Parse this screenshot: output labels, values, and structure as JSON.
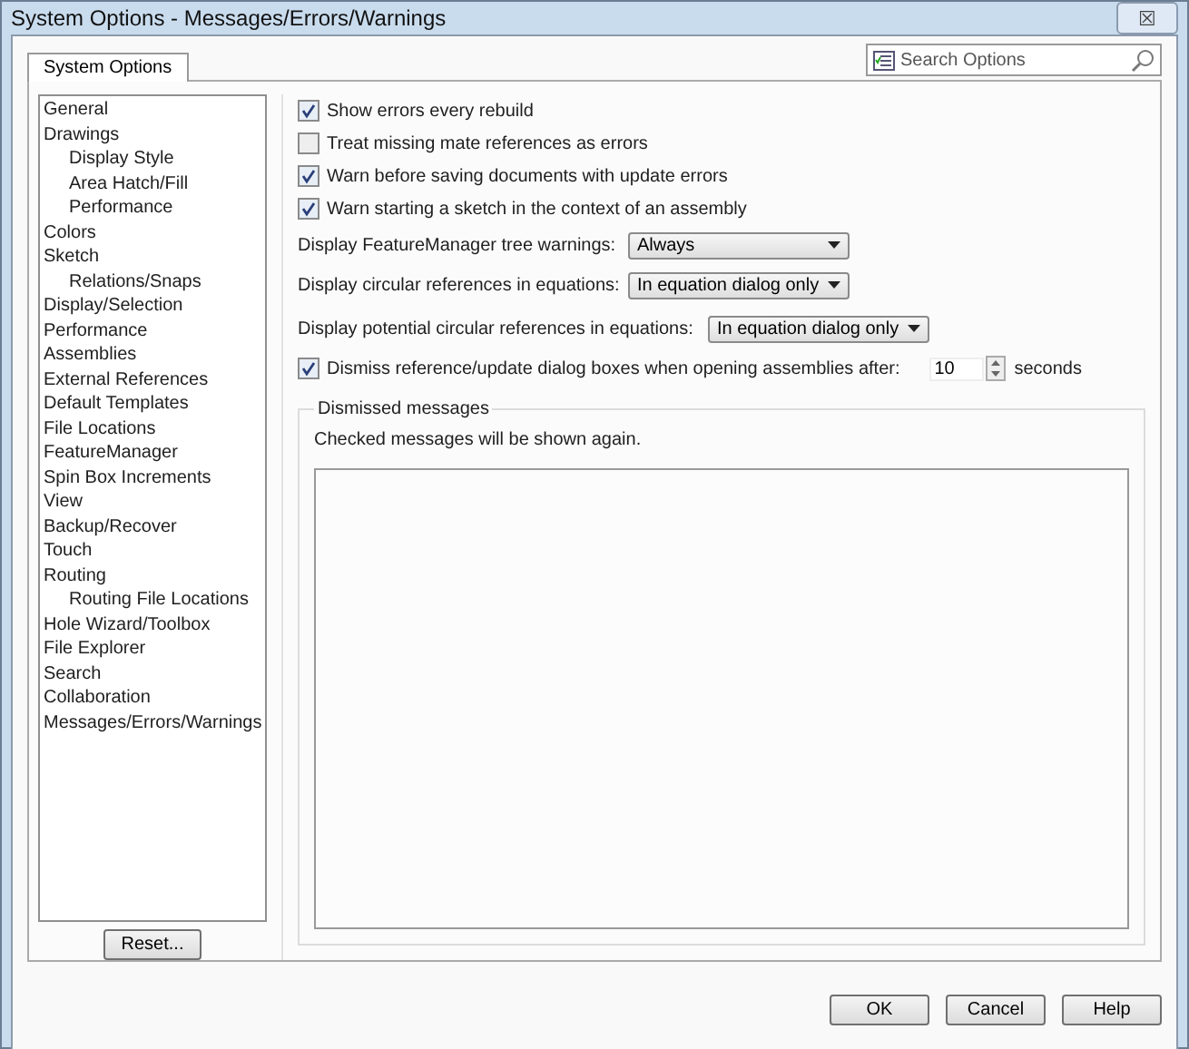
{
  "window": {
    "title": "System Options - Messages/Errors/Warnings",
    "close": "☒"
  },
  "tab": {
    "label": "System Options",
    "selected": true
  },
  "search": {
    "placeholder": "Search Options"
  },
  "tree": [
    {
      "label": "General"
    },
    {
      "label": "Drawings",
      "children": [
        {
          "label": "Display Style"
        },
        {
          "label": "Area Hatch/Fill"
        },
        {
          "label": "Performance"
        }
      ]
    },
    {
      "label": "Colors"
    },
    {
      "label": "Sketch",
      "children": [
        {
          "label": "Relations/Snaps"
        }
      ]
    },
    {
      "label": "Display/Selection"
    },
    {
      "label": "Performance"
    },
    {
      "label": "Assemblies"
    },
    {
      "label": "External References"
    },
    {
      "label": "Default Templates"
    },
    {
      "label": "File Locations"
    },
    {
      "label": "FeatureManager"
    },
    {
      "label": "Spin Box Increments"
    },
    {
      "label": "View"
    },
    {
      "label": "Backup/Recover"
    },
    {
      "label": "Touch"
    },
    {
      "label": "Routing",
      "children": [
        {
          "label": "Routing File Locations"
        }
      ]
    },
    {
      "label": "Hole Wizard/Toolbox"
    },
    {
      "label": "File Explorer"
    },
    {
      "label": "Search"
    },
    {
      "label": "Collaboration"
    },
    {
      "label": "Messages/Errors/Warnings"
    }
  ],
  "reset_button": "Reset...",
  "options": [
    {
      "kind": "checkbox",
      "label": "Show errors every rebuild",
      "checked": true
    },
    {
      "kind": "checkbox",
      "label": "Treat missing mate references as errors",
      "checked": false
    },
    {
      "kind": "checkbox",
      "label": "Warn before saving documents with update errors",
      "checked": true
    },
    {
      "kind": "checkbox",
      "label": "Warn starting a sketch in the context of an assembly",
      "checked": true
    },
    {
      "kind": "dropdown",
      "label": "Display FeatureManager tree warnings:",
      "value": "Always"
    },
    {
      "kind": "dropdown",
      "label": "Display circular references in equations:",
      "value": "In equation dialog only"
    },
    {
      "kind": "dropdown",
      "label": "Display potential circular references in equations:",
      "value": "In equation dialog only"
    },
    {
      "kind": "spinner",
      "label": "Dismiss reference/update dialog boxes when opening assemblies after:",
      "checked": true,
      "value": "10",
      "unit": "seconds"
    }
  ],
  "dismissed": {
    "title": "Dismissed messages",
    "hint": "Checked messages will be shown again."
  },
  "buttons": [
    "OK",
    "Cancel",
    "Help"
  ]
}
